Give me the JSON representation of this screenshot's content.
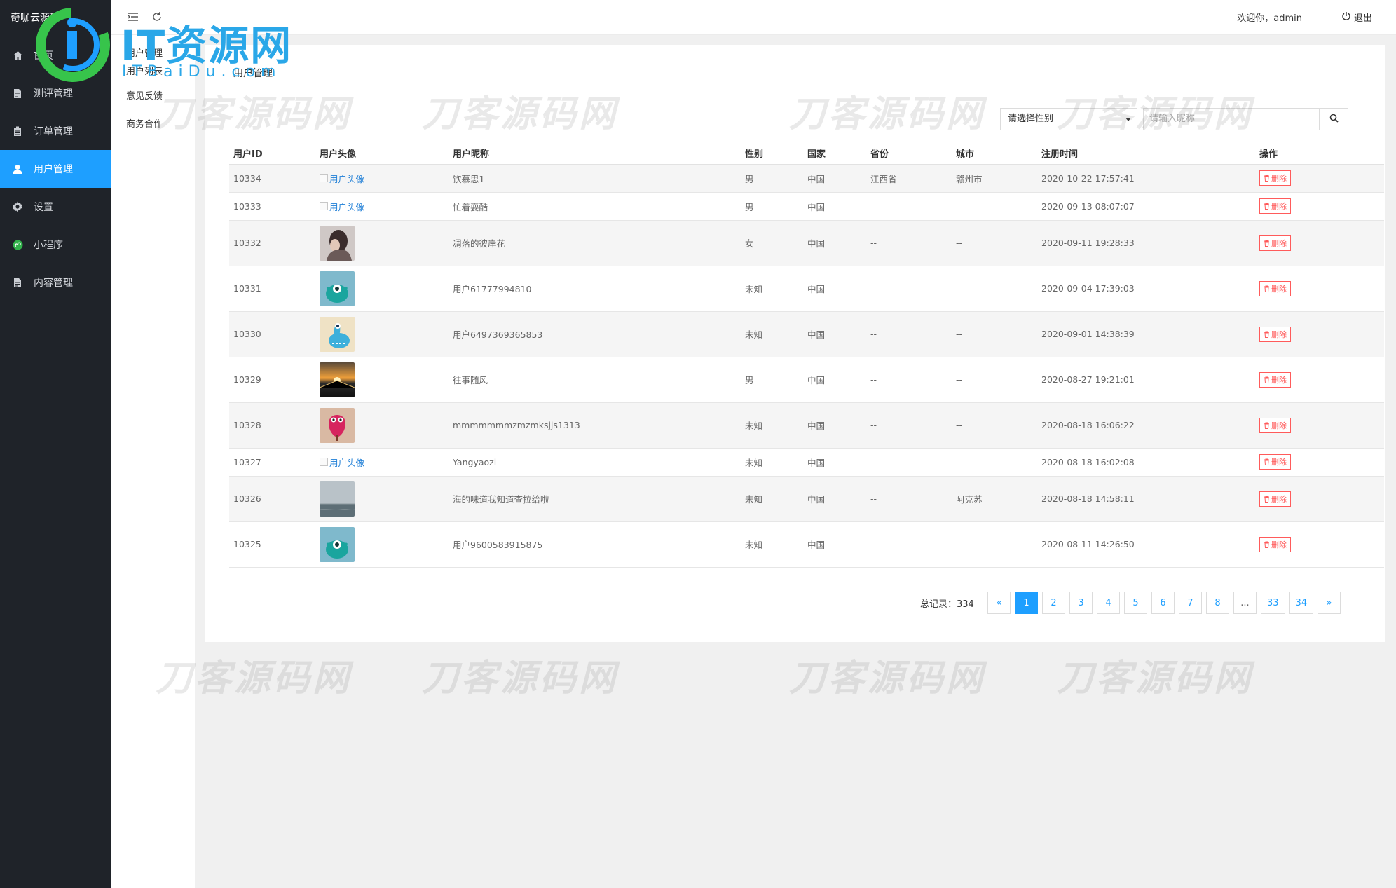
{
  "brand": "奇咖云源码",
  "logo": {
    "main": "IT资源网",
    "sub": "ITBaiDu.com"
  },
  "watermark": "刀客源码网",
  "sidebar": {
    "items": [
      {
        "label": "首页",
        "icon": "home-icon"
      },
      {
        "label": "测评管理",
        "icon": "document-icon"
      },
      {
        "label": "订单管理",
        "icon": "clipboard-icon"
      },
      {
        "label": "用户管理",
        "icon": "user-icon",
        "active": true
      },
      {
        "label": "设置",
        "icon": "gear-icon"
      },
      {
        "label": "小程序",
        "icon": "miniprogram-icon"
      },
      {
        "label": "内容管理",
        "icon": "document-icon"
      }
    ]
  },
  "subnav": {
    "title": "用户管理",
    "items": [
      "用户列表",
      "意见反馈",
      "商务合作"
    ]
  },
  "header": {
    "welcome": "欢迎你，admin",
    "logout": "退出"
  },
  "card": {
    "title": "用户管理",
    "gender_select": "请选择性别",
    "search_placeholder": "请输入昵称"
  },
  "table": {
    "columns": [
      "用户ID",
      "用户头像",
      "用户昵称",
      "性别",
      "国家",
      "省份",
      "城市",
      "注册时间",
      "操作"
    ],
    "avatar_alt": "用户头像",
    "delete_label": "删除",
    "rows": [
      {
        "id": "10334",
        "avatar": "broken",
        "nickname": "饮慕思1",
        "gender": "男",
        "country": "中国",
        "province": "江西省",
        "city": "赣州市",
        "time": "2020-10-22 17:57:41"
      },
      {
        "id": "10333",
        "avatar": "broken",
        "nickname": "忙着耍酷",
        "gender": "男",
        "country": "中国",
        "province": "--",
        "city": "--",
        "time": "2020-09-13 08:07:07"
      },
      {
        "id": "10332",
        "avatar": "photo-person",
        "nickname": "凋落的彼岸花",
        "gender": "女",
        "country": "中国",
        "province": "--",
        "city": "--",
        "time": "2020-09-11 19:28:33"
      },
      {
        "id": "10331",
        "avatar": "monster-teal",
        "nickname": "用户61777994810",
        "gender": "未知",
        "country": "中国",
        "province": "--",
        "city": "--",
        "time": "2020-09-04 17:39:03"
      },
      {
        "id": "10330",
        "avatar": "monster-blue",
        "nickname": "用户6497369365853",
        "gender": "未知",
        "country": "中国",
        "province": "--",
        "city": "--",
        "time": "2020-09-01 14:38:39"
      },
      {
        "id": "10329",
        "avatar": "photo-sunset",
        "nickname": "往事随风",
        "gender": "男",
        "country": "中国",
        "province": "--",
        "city": "--",
        "time": "2020-08-27 19:21:01"
      },
      {
        "id": "10328",
        "avatar": "monster-pink",
        "nickname": "mmmmmmmzmzmksjjs1313",
        "gender": "未知",
        "country": "中国",
        "province": "--",
        "city": "--",
        "time": "2020-08-18 16:06:22"
      },
      {
        "id": "10327",
        "avatar": "broken",
        "nickname": "Yangyaozi",
        "gender": "未知",
        "country": "中国",
        "province": "--",
        "city": "--",
        "time": "2020-08-18 16:02:08"
      },
      {
        "id": "10326",
        "avatar": "photo-sea",
        "nickname": "海的味道我知道查拉给啦",
        "gender": "未知",
        "country": "中国",
        "province": "--",
        "city": "阿克苏",
        "time": "2020-08-18 14:58:11"
      },
      {
        "id": "10325",
        "avatar": "monster-teal",
        "nickname": "用户9600583915875",
        "gender": "未知",
        "country": "中国",
        "province": "--",
        "city": "--",
        "time": "2020-08-11 14:26:50"
      }
    ]
  },
  "pagination": {
    "total_label": "总记录：334",
    "pages": [
      "«",
      "1",
      "2",
      "3",
      "4",
      "5",
      "6",
      "7",
      "8",
      "...",
      "33",
      "34",
      "»"
    ],
    "current": "1"
  }
}
